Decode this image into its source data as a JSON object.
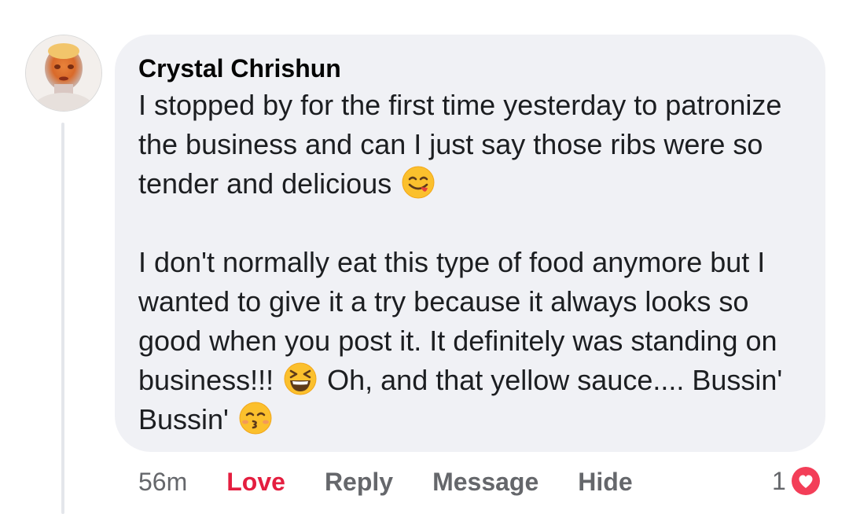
{
  "comment": {
    "author": "Crystal Chrishun",
    "paragraph1": {
      "text": "I stopped by for the first time yesterday to patronize the business and can I just say those ribs were so tender and delicious",
      "emoji_end": "savoring-food-emoji"
    },
    "paragraph2": {
      "text_a": "I don't normally eat this type of food anymore but I wanted to give it a try because it always looks so good when you post it. It definitely was standing on business!!!",
      "emoji_mid": "grinning-squinting-emoji",
      "text_b": "Oh, and that yellow sauce.... Bussin' Bussin'",
      "emoji_end": "kissing-smiling-eyes-emoji"
    }
  },
  "actions": {
    "timestamp": "56m",
    "love_label": "Love",
    "reply_label": "Reply",
    "message_label": "Message",
    "hide_label": "Hide"
  },
  "reactions": {
    "count": "1",
    "icon": "heart-reaction-icon"
  },
  "colors": {
    "bubble_bg": "#f0f1f5",
    "love_red": "#e41e3f",
    "action_gray": "#65676b",
    "thread_line": "#e4e6eb"
  }
}
